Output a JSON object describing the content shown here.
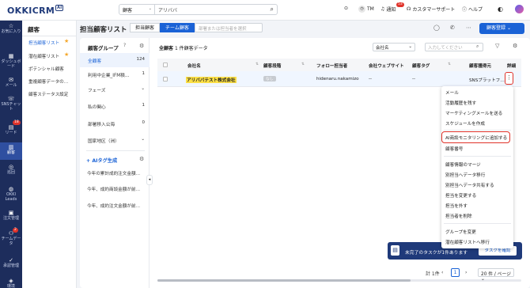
{
  "app": {
    "logo": "OKKICRM",
    "logo_ai": "AI"
  },
  "search": {
    "scope": "顧客",
    "query": "アリババ"
  },
  "topnav": {
    "tm": "TM",
    "notify": "通知",
    "notify_badge": "53",
    "support": "カスタマーサポート",
    "help": "ヘルプ"
  },
  "leftnav": {
    "favorites": "お気に入り",
    "dashboard": "ダッシュボード",
    "mail": "メール",
    "sns": "SNSチャット",
    "sns_badge": "18",
    "leads": "リード",
    "customers": "顧客",
    "inspection": "巡回",
    "okki_leads": "OKKI Leads",
    "orders": "注文管理",
    "team": "チームデータ",
    "team_badge": "2",
    "approval": "承認管理",
    "env": "環境"
  },
  "subnav": {
    "title": "顧客",
    "items": [
      "担当顧客リスト",
      "潜在顧客リスト",
      "ポテンシャル顧客",
      "重複顧客データの…",
      "顧客ステータス設定"
    ]
  },
  "header": {
    "title": "担当顧客リスト",
    "tab_assigned": "担当顧客",
    "tab_team": "チーム顧客",
    "owner_placeholder": "部署または担当者を選択",
    "register": "顧客登録"
  },
  "groups": {
    "title": "顧客グループ",
    "rows": [
      {
        "label": "全顧客",
        "count": "124"
      },
      {
        "label": "利用中企業_IFM積…",
        "count": "1"
      },
      {
        "label": "フェーズ",
        "count": ""
      },
      {
        "label": "私の関心",
        "count": "1"
      },
      {
        "label": "部署移入公海",
        "count": "0"
      },
      {
        "label": "国家地区（洲）",
        "count": ""
      }
    ],
    "ai_title": "+ AIタグ生成",
    "ai_items": [
      "今年の累計成約注文金額…",
      "今年、成約商談金額が前…",
      "今年、成約注文金額が前…"
    ]
  },
  "list": {
    "count_label": "全顧客",
    "count_text": "1 件顧客データ",
    "filter": "会社名",
    "keyword_placeholder": "入力してください"
  },
  "table": {
    "headers": [
      "会社名",
      "顧客段階",
      "フォロー担当者",
      "会社ウェブサイト",
      "顧客タグ",
      "顧客獲得元",
      "詳細"
    ],
    "row": {
      "company": "アリババテスト株式会社",
      "stage": "なし",
      "owner": "hidenaru.nakamizo",
      "website": "--",
      "tag": "--",
      "source": "SNSプラットフ…"
    }
  },
  "menu": {
    "items": [
      "メール",
      "活動履歴を残す",
      "マーケティングメールを送る",
      "スケジュールを作成",
      "AI商談モニタリングに追加する",
      "顧客番号",
      "顧客情報のマージ",
      "別担当ヘデータ移行",
      "別担当ヘデータ共有する",
      "担当を変更する",
      "担当を外す",
      "担当者を削除",
      "グループを変更",
      "潜在顧客リストへ移行"
    ]
  },
  "pagination": {
    "total": "計 1件",
    "page": "1",
    "per_page": "20 件 / ページ"
  },
  "toast": {
    "text": "未完了のタスクが1件あります",
    "button": "タスクを確認"
  }
}
